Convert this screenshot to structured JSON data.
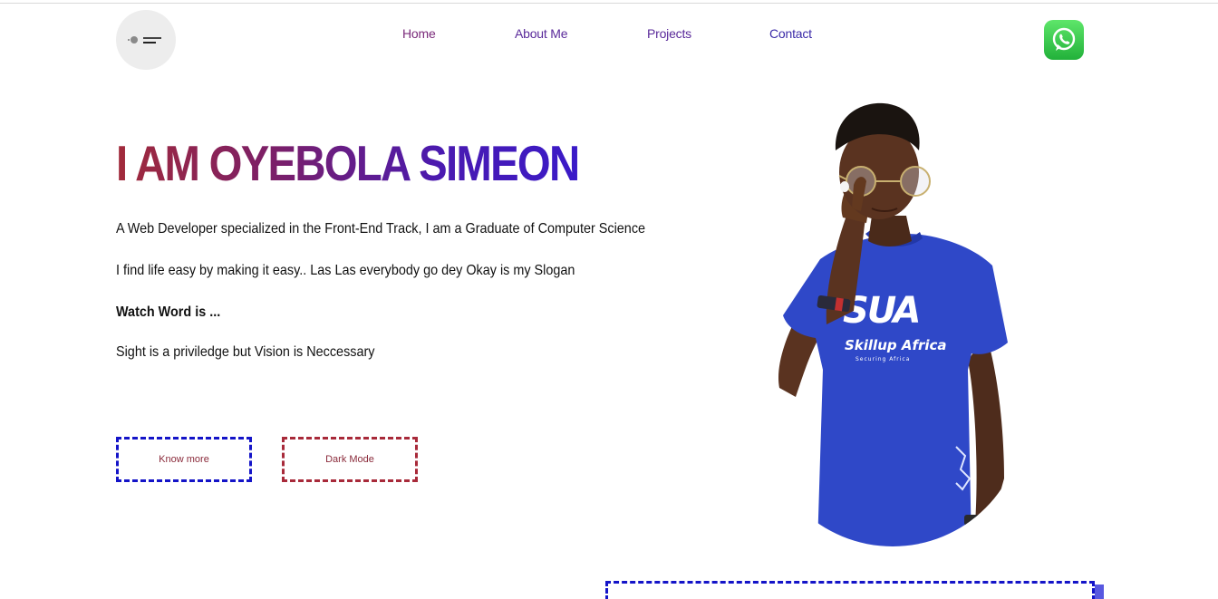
{
  "nav": {
    "items": [
      {
        "label": "Home"
      },
      {
        "label": "About Me"
      },
      {
        "label": "Projects"
      },
      {
        "label": "Contact"
      }
    ]
  },
  "icons": {
    "logo": "logo-avatar",
    "whatsapp": "whatsapp-icon"
  },
  "hero": {
    "title": "I AM OYEBOLA SIMEON",
    "intro": "A Web Developer specialized in the Front-End Track, I am a Graduate of Computer Science",
    "slogan": "I find life easy by making it easy.. Las Las everybody go dey Okay is my Slogan",
    "watchword_label": "Watch Word is ...",
    "watchword": "Sight is a priviledge but Vision is Neccessary"
  },
  "buttons": {
    "know_more": "Know more",
    "dark_mode": "Dark Mode"
  },
  "portrait": {
    "shirt_brand": "Skillup Africa",
    "shirt_logo": "SUA",
    "shirt_tagline": "Securing Africa"
  },
  "colors": {
    "title_gradient_start": "#a12a3a",
    "title_gradient_end": "#3a1ac8",
    "accent_blue": "#1414c8",
    "accent_red": "#a82a3a",
    "whatsapp_green": "#25d366"
  }
}
